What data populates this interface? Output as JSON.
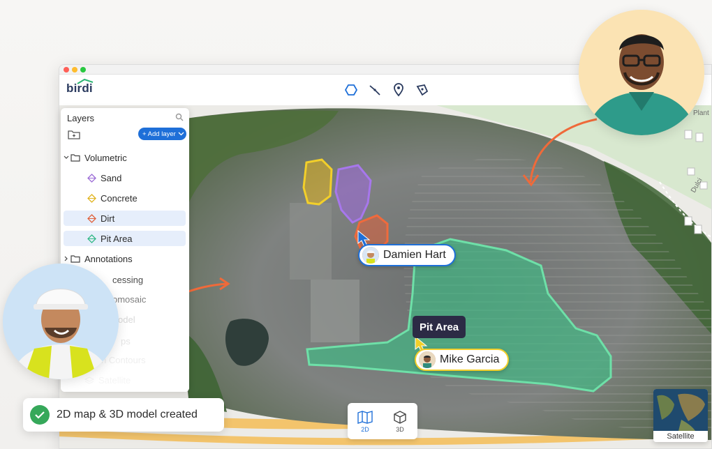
{
  "app": {
    "logo": "birdi"
  },
  "toolbar": {
    "tools": [
      "polygon-tool-icon",
      "line-tool-icon",
      "marker-tool-icon",
      "pen-tool-icon"
    ]
  },
  "layers": {
    "title": "Layers",
    "add_layer_label": "+ Add layer",
    "items": [
      {
        "label": "Volumetric",
        "type": "folder",
        "expanded": true
      },
      {
        "label": "Sand",
        "color": "#9b6bd6"
      },
      {
        "label": "Concrete",
        "color": "#e0b31d"
      },
      {
        "label": "Dirt",
        "color": "#e0603a"
      },
      {
        "label": "Pit Area",
        "color": "#32b886"
      },
      {
        "label": "Annotations",
        "type": "folder",
        "expanded": false
      },
      {
        "label": "cessing"
      },
      {
        "label": "omosaic"
      },
      {
        "label": "odel"
      },
      {
        "label": "ps"
      },
      {
        "label": "n Contours"
      },
      {
        "label": "Satellite"
      }
    ]
  },
  "map": {
    "labels": {
      "pit_area": "Pit Area",
      "plant": "Plant",
      "dulci": "Dulci"
    },
    "users": [
      {
        "name": "Damien Hart"
      },
      {
        "name": "Mike Garcia"
      }
    ]
  },
  "toast": {
    "text": "2D map & 3D model created"
  },
  "view_toggle": {
    "options": [
      "2D",
      "3D"
    ],
    "active": "2D"
  },
  "basemap": {
    "label": "Satellite"
  },
  "colors": {
    "accent": "#1e6fd8",
    "sand": "#9b6bd6",
    "concrete": "#e0b31d",
    "dirt": "#e0603a",
    "pit": "#32b886",
    "arrow": "#ef6a3a"
  }
}
